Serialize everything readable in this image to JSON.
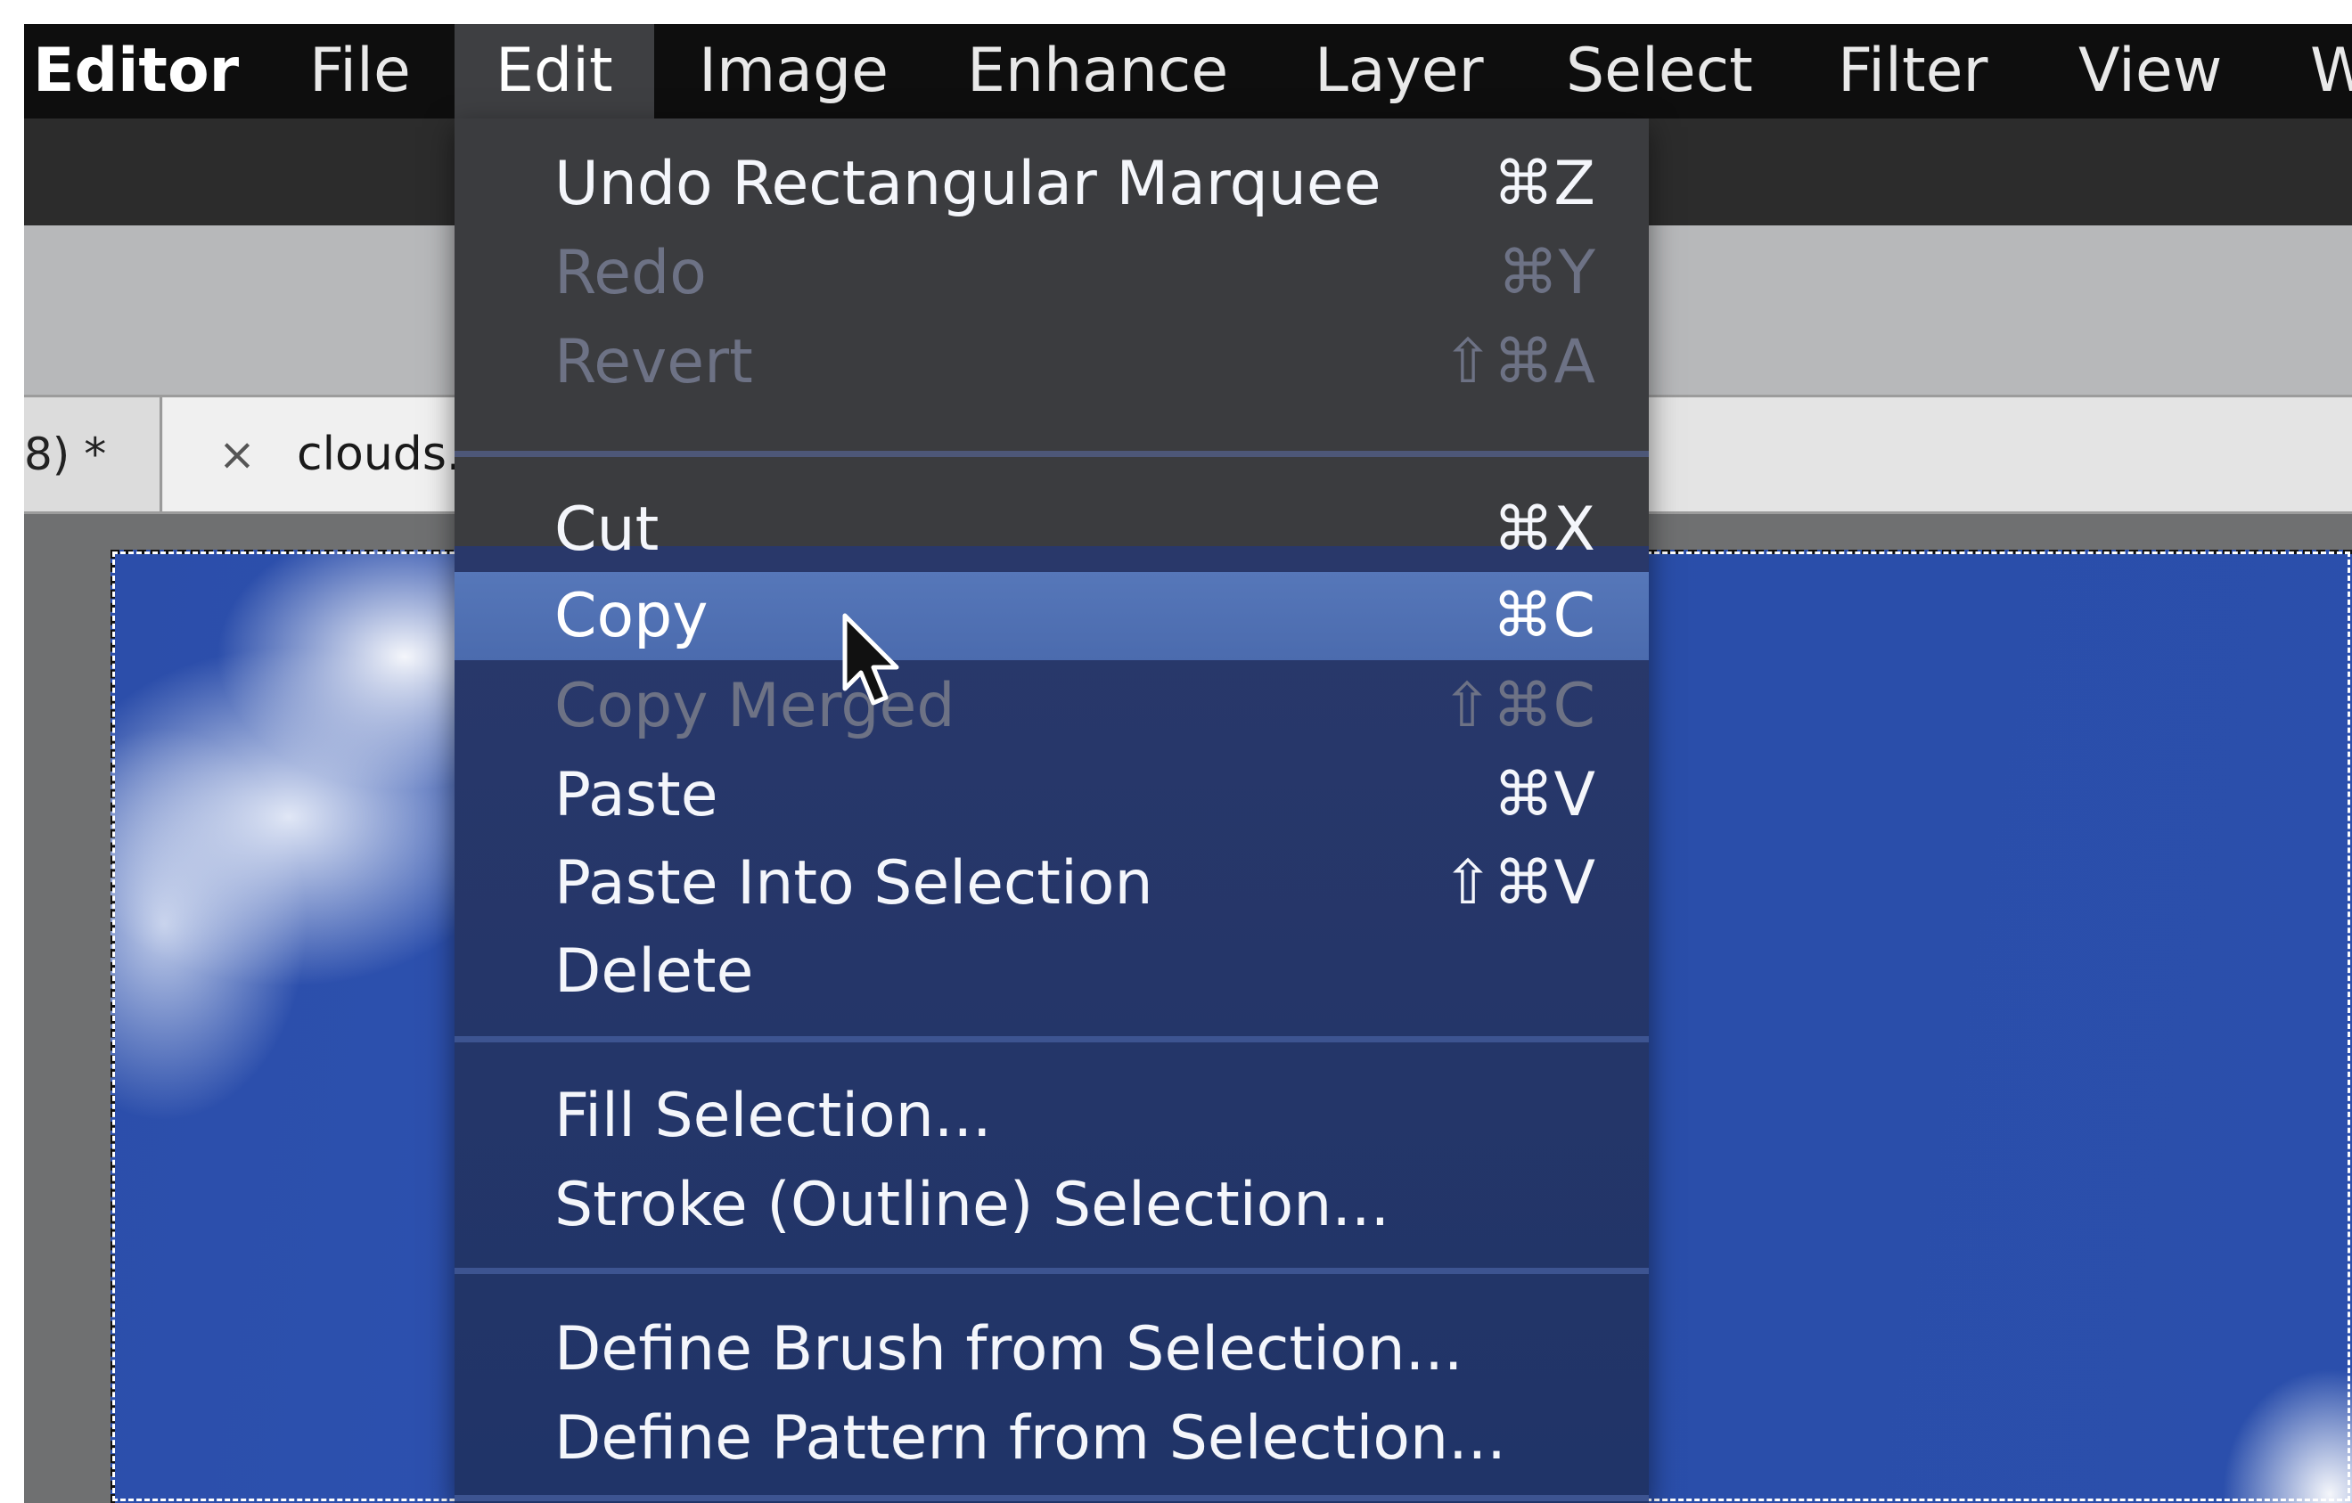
{
  "menubar": {
    "app_label": "Editor",
    "items": [
      "File",
      "Edit",
      "Image",
      "Enhance",
      "Layer",
      "Select",
      "Filter",
      "View",
      "W"
    ]
  },
  "tabs": {
    "previous_tab_label": "8) *",
    "close_glyph": "×",
    "current_tab_label": "clouds."
  },
  "edit_menu": {
    "items": [
      {
        "label": "Undo Rectangular Marquee",
        "shortcut": "⌘Z"
      },
      {
        "label": "Redo",
        "shortcut": "⌘Y"
      },
      {
        "label": "Revert",
        "shortcut": "⇧⌘A"
      },
      {
        "label": "Cut",
        "shortcut": "⌘X"
      },
      {
        "label": "Copy",
        "shortcut": "⌘C"
      },
      {
        "label": "Copy Merged",
        "shortcut": "⇧⌘C"
      },
      {
        "label": "Paste",
        "shortcut": "⌘V"
      },
      {
        "label": "Paste Into Selection",
        "shortcut": "⇧⌘V"
      },
      {
        "label": "Delete",
        "shortcut": ""
      },
      {
        "label": "Fill Selection...",
        "shortcut": ""
      },
      {
        "label": "Stroke (Outline) Selection...",
        "shortcut": ""
      },
      {
        "label": "Define Brush from Selection...",
        "shortcut": ""
      },
      {
        "label": "Define Pattern from Selection...",
        "shortcut": ""
      }
    ]
  },
  "colors": {
    "menu_highlight": "#5677b9",
    "menu_background": "#29386a",
    "disabled_text": "#6d7285",
    "sky_blue": "#2c4eaa"
  },
  "icons": {
    "cursor": "arrow-pointer-icon",
    "tab_close": "close-icon"
  }
}
